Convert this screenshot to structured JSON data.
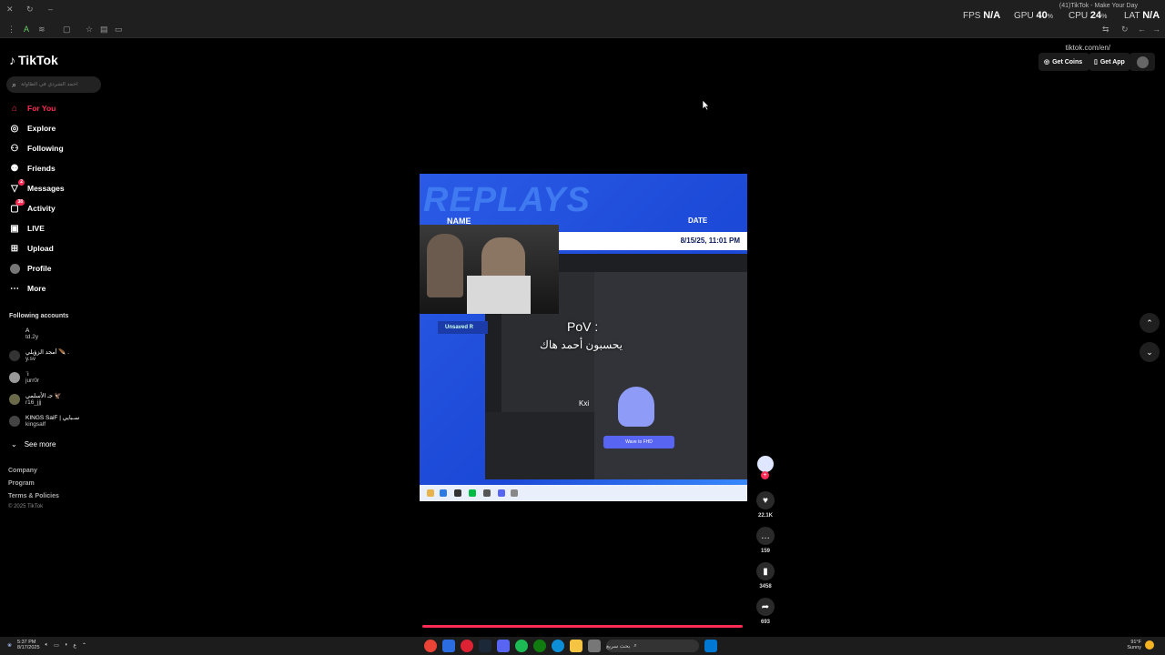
{
  "browser": {
    "tab_title": "(41)TikTok - Make Your Day",
    "url": "tiktok.com/en/",
    "overlay": {
      "fps_label": "FPS",
      "fps_value": "N/A",
      "gpu_label": "GPU",
      "gpu_value": "40",
      "cpu_label": "CPU",
      "cpu_value": "24",
      "lat_label": "LAT",
      "lat_value": "N/A",
      "pct": "%"
    }
  },
  "brand": {
    "name": "TikTok"
  },
  "search": {
    "placeholder": "احمد الشردي في الطاولة"
  },
  "nav": [
    {
      "label": "For You",
      "icon": "home-icon"
    },
    {
      "label": "Explore",
      "icon": "compass-icon"
    },
    {
      "label": "Following",
      "icon": "following-icon"
    },
    {
      "label": "Friends",
      "icon": "friends-icon"
    },
    {
      "label": "Messages",
      "icon": "messages-icon",
      "badge": "2"
    },
    {
      "label": "Activity",
      "icon": "activity-icon",
      "badge": "38"
    },
    {
      "label": "LIVE",
      "icon": "live-icon"
    },
    {
      "label": "Upload",
      "icon": "upload-icon"
    },
    {
      "label": "Profile",
      "icon": "profile-icon"
    },
    {
      "label": "More",
      "icon": "more-icon"
    }
  ],
  "following_accounts": {
    "title": "Following accounts",
    "items": [
      {
        "name": "A",
        "handle": "td.2y"
      },
      {
        "name": "أمجد الزؤيلي 🪶 .",
        "handle": "y.sv"
      },
      {
        "name": "ʿi",
        "handle": "jurr0r"
      },
      {
        "name": "جـ الأسلمي 🦅",
        "handle": "r16_jjj"
      },
      {
        "name": "KINGS SaiF | سـبايي",
        "handle": "kingsalf"
      }
    ],
    "see_more": "See more"
  },
  "footer": {
    "links": [
      "Company",
      "Program",
      "Terms & Policies"
    ],
    "copyright": "© 2025 TikTok"
  },
  "top_right": {
    "get_coins": "Get Coins",
    "get_app": "Get App"
  },
  "video": {
    "banner": "REPLAYS",
    "header_name": "NAME",
    "header_date": "DATE",
    "date_value": "8/15/25, 11:01 PM",
    "unsaved": "Unsaved R",
    "caption_line1": "PoV :",
    "caption_line2": "يحسبون أحمد هاك",
    "overlay_tag": "Kxi",
    "wave_button": "Wave to FHD"
  },
  "actions": {
    "likes": "22.1K",
    "comments": "159",
    "saves": "3458",
    "shares": "693"
  },
  "taskbar": {
    "time": "5:37 PM",
    "date": "8/17/2025",
    "search_placeholder": "بحث سريع",
    "weather_temp": "91°F",
    "weather_desc": "Sunny",
    "lang": "ع"
  }
}
